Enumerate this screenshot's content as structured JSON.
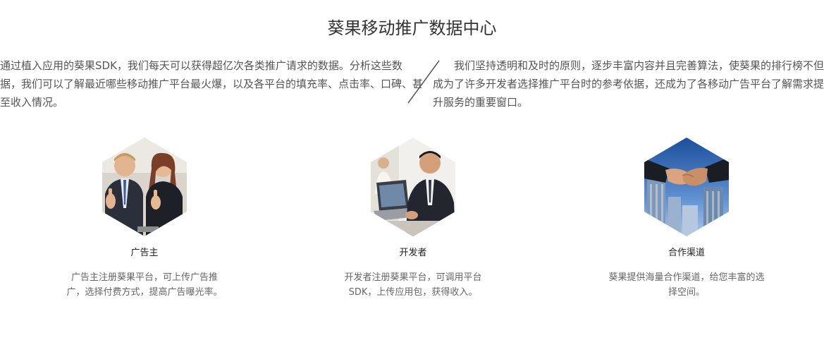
{
  "header": {
    "title": "葵果移动推广数据中心"
  },
  "intro": {
    "left": "通过植入应用的葵果SDK，我们每天可以获得超亿次各类推广请求的数据。分析这些数据，我们可以了解最近哪些移动推广平台最火爆，以及各平台的填充率、点击率、口碑、甚至收入情况。",
    "right": "我们坚持透明和及时的原则，逐步丰富内容并且完善算法，使葵果的排行榜不但成为了许多开发者选择推广平台时的参考依据，还成为了各移动广告平台了解需求提升服务的重要窗口。"
  },
  "cards": [
    {
      "title": "广告主",
      "desc": "广告主注册葵果平台，可上传广告推广，选择付费方式，提高广告曝光率。",
      "image": "advertisers-thumbs-up-photo"
    },
    {
      "title": "开发者",
      "desc": "开发者注册葵果平台，可调用平台SDK，上传应用包，获得收入。",
      "image": "developer-at-laptop-photo"
    },
    {
      "title": "合作渠道",
      "desc": "葵果提供海量合作渠道，给您丰富的选择空间。",
      "image": "handshake-photo"
    }
  ],
  "colors": {
    "text_dark": "#333333",
    "text_body": "#555555",
    "text_muted": "#666666",
    "divider": "#555555"
  }
}
